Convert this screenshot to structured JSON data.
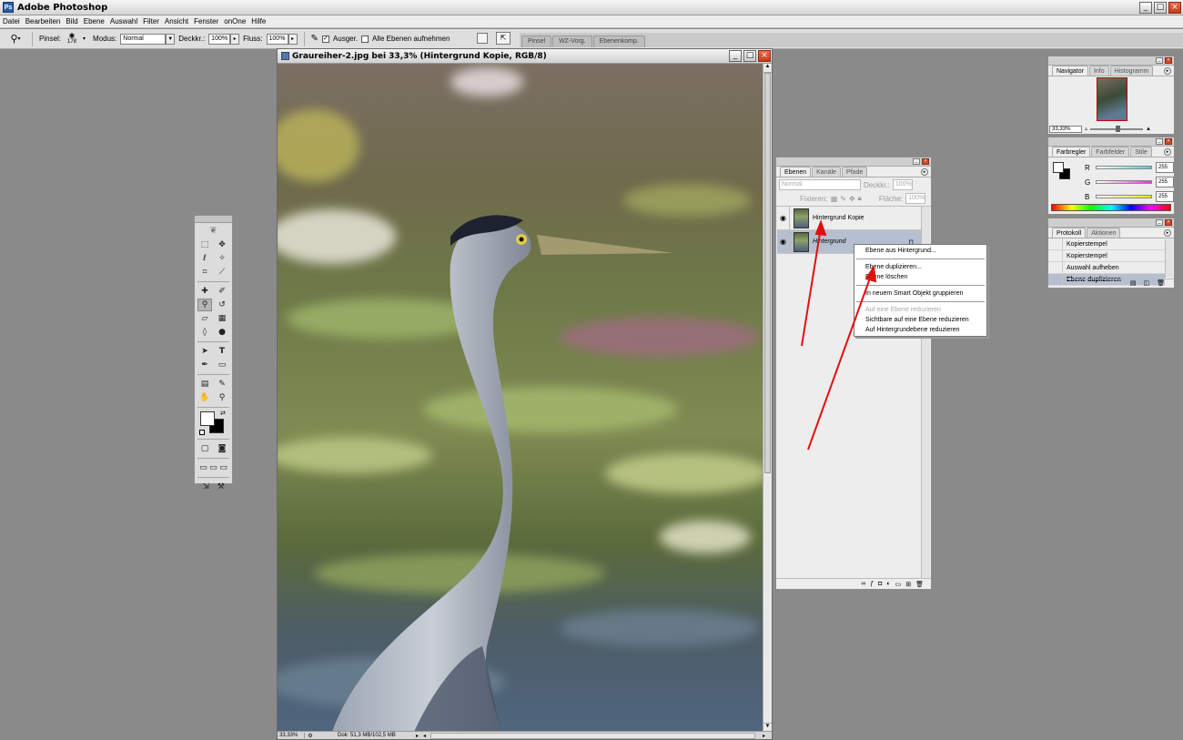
{
  "app": {
    "title": "Adobe Photoshop"
  },
  "menubar": {
    "items": [
      "Datei",
      "Bearbeiten",
      "Bild",
      "Ebene",
      "Auswahl",
      "Filter",
      "Ansicht",
      "Fenster",
      "onOne",
      "Hilfe"
    ]
  },
  "options": {
    "brush_label": "Pinsel:",
    "brush_size": "178",
    "mode_label": "Modus:",
    "mode_value": "Normal",
    "opacity_label": "Deckkr.:",
    "opacity_value": "100%",
    "flow_label": "Fluss:",
    "flow_value": "100%",
    "aligned_label": "Ausger.",
    "all_layers_label": "Alle Ebenen aufnehmen"
  },
  "palette_well": {
    "tabs": [
      "Pinsel",
      "WZ-Vorg.",
      "Ebenenkomp."
    ]
  },
  "document": {
    "title": "Graureiher-2.jpg bei 33,3% (Hintergrund Kopie, RGB/8)",
    "zoom": "33,33%",
    "doc_info": "Dok: 51,3 MB/102,5 MB"
  },
  "layers_panel": {
    "tabs": [
      "Ebenen",
      "Kanäle",
      "Pfade"
    ],
    "blend_mode": "Normal",
    "opacity_label": "Deckkr.:",
    "opacity_value": "100%",
    "lock_label": "Fixieren:",
    "fill_label": "Fläche:",
    "fill_value": "100%",
    "layers": [
      "Hintergrund Kopie",
      "Hintergrund"
    ]
  },
  "context_menu": {
    "items": [
      {
        "label": "Ebene aus Hintergrund...",
        "enabled": true
      },
      {
        "label": "Ebene duplizieren...",
        "enabled": true
      },
      {
        "label": "Ebene löschen",
        "enabled": true
      },
      {
        "label": "In neuem Smart Objekt gruppieren",
        "enabled": true
      },
      {
        "label": "Auf eine Ebene reduzieren",
        "enabled": false
      },
      {
        "label": "Sichtbare auf eine Ebene reduzieren",
        "enabled": true
      },
      {
        "label": "Auf Hintergrundebene reduzieren",
        "enabled": true
      }
    ]
  },
  "navigator_panel": {
    "tabs": [
      "Navigator",
      "Info",
      "Histogramm"
    ],
    "zoom": "33,33%"
  },
  "color_panel": {
    "tabs": [
      "Farbregler",
      "Farbfelder",
      "Stile"
    ],
    "channels": [
      {
        "label": "R",
        "value": "255",
        "color": "#36d6d6"
      },
      {
        "label": "G",
        "value": "255",
        "color": "#e03ad0"
      },
      {
        "label": "B",
        "value": "255",
        "color": "#e8e81c"
      }
    ]
  },
  "history_panel": {
    "tabs": [
      "Protokoll",
      "Aktionen"
    ],
    "items": [
      "Kopierstempel",
      "Kopierstempel",
      "Auswahl aufheben",
      "Ebene duplizieren"
    ],
    "selected_index": 3
  },
  "annotations": {
    "arrow_color": "#e01010"
  }
}
